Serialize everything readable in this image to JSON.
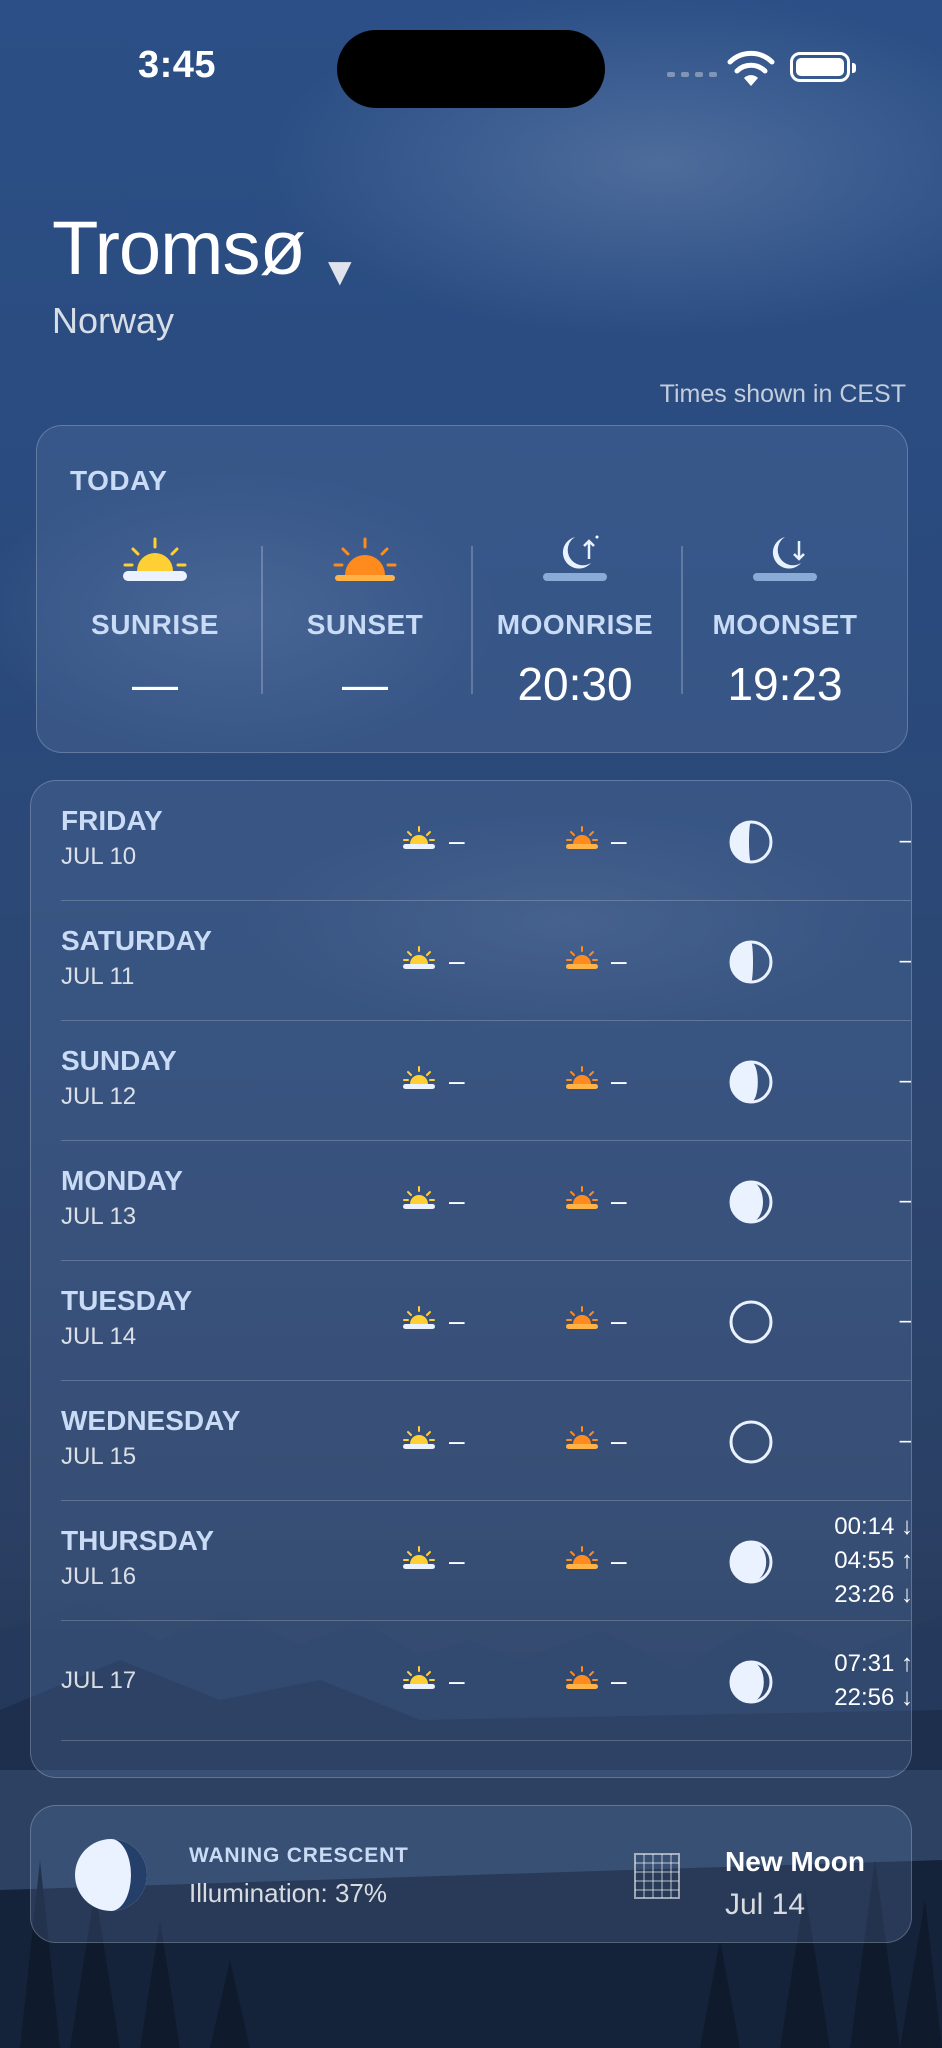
{
  "status": {
    "time": "3:45"
  },
  "location": {
    "city": "Tromsø",
    "country": "Norway",
    "timezone_note": "Times shown in CEST"
  },
  "today": {
    "label": "TODAY",
    "items": [
      {
        "label": "SUNRISE",
        "value": "—",
        "icon": "sunrise-icon"
      },
      {
        "label": "SUNSET",
        "value": "—",
        "icon": "sunset-icon"
      },
      {
        "label": "MOONRISE",
        "value": "20:30",
        "icon": "moonrise-icon"
      },
      {
        "label": "MOONSET",
        "value": "19:23",
        "icon": "moonset-icon"
      }
    ]
  },
  "days": [
    {
      "day": "FRIDAY",
      "date": "JUL 10",
      "sunrise": "–",
      "sunset": "–",
      "moon_illumination": 0.55,
      "moon_times": [
        "–"
      ]
    },
    {
      "day": "SATURDAY",
      "date": "JUL 11",
      "sunrise": "–",
      "sunset": "–",
      "moon_illumination": 0.45,
      "moon_times": [
        "–"
      ]
    },
    {
      "day": "SUNDAY",
      "date": "JUL 12",
      "sunrise": "–",
      "sunset": "–",
      "moon_illumination": 0.33,
      "moon_times": [
        "–"
      ]
    },
    {
      "day": "MONDAY",
      "date": "JUL 13",
      "sunrise": "–",
      "sunset": "–",
      "moon_illumination": 0.2,
      "moon_times": [
        "–"
      ]
    },
    {
      "day": "TUESDAY",
      "date": "JUL 14",
      "sunrise": "–",
      "sunset": "–",
      "moon_illumination": 0.0,
      "moon_times": [
        "–"
      ]
    },
    {
      "day": "WEDNESDAY",
      "date": "JUL 15",
      "sunrise": "–",
      "sunset": "–",
      "moon_illumination": 0.0,
      "moon_times": [
        "–"
      ]
    },
    {
      "day": "THURSDAY",
      "date": "JUL 16",
      "sunrise": "–",
      "sunset": "–",
      "moon_illumination": 0.12,
      "moon_times": [
        "00:14 ↓",
        "04:55 ↑",
        "23:26 ↓"
      ]
    },
    {
      "day": "",
      "date": "JUL 17",
      "sunrise": "–",
      "sunset": "–",
      "moon_illumination": 0.18,
      "moon_times": [
        "07:31 ↑",
        "22:56 ↓"
      ]
    }
  ],
  "moon_phase": {
    "name": "WANING CRESCENT",
    "illumination": "Illumination: 37%"
  },
  "next_phase": {
    "name": "New Moon",
    "date": "Jul 14"
  },
  "colors": {
    "accent_label": "#c9dbf5",
    "sun": "#ffcf33",
    "sunset": "#ff8a1e"
  }
}
